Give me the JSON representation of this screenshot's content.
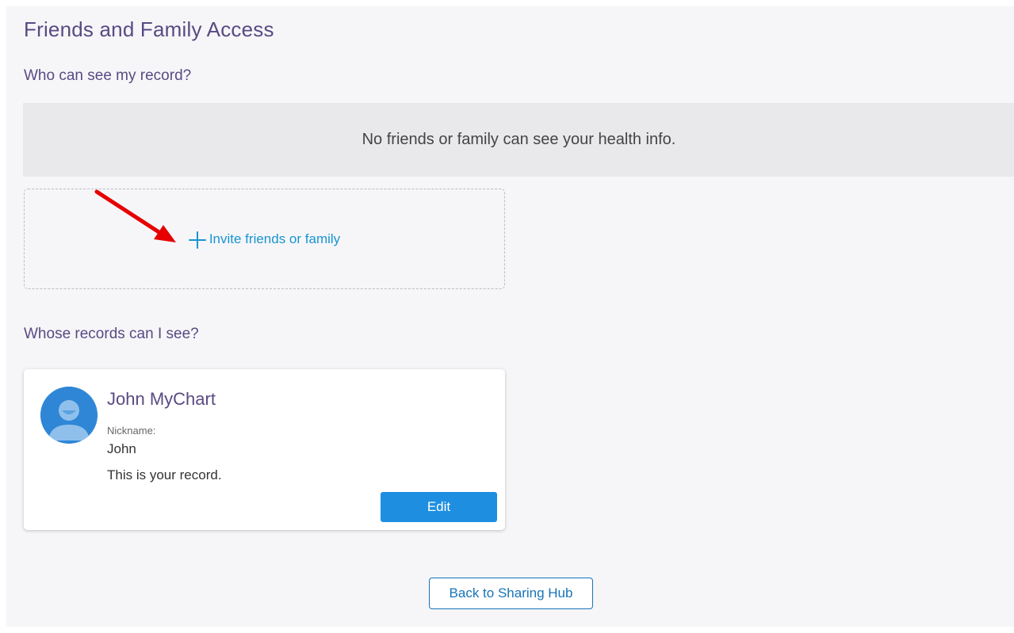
{
  "page": {
    "title": "Friends and Family Access"
  },
  "who_can_see": {
    "heading": "Who can see my record?",
    "empty_message": "No friends or family can see your health info.",
    "invite_label": "Invite friends or family"
  },
  "whose_records": {
    "heading": "Whose records can I see?",
    "records": [
      {
        "name": "John MyChart",
        "nickname_label": "Nickname:",
        "nickname": "John",
        "note": "This is your record.",
        "edit_label": "Edit"
      }
    ]
  },
  "footer": {
    "back_label": "Back to Sharing Hub"
  },
  "colors": {
    "accent": "#5a4a82",
    "link": "#1895d1",
    "button_primary": "#1e8fe0",
    "annotation_arrow": "#e60000"
  },
  "icons": {
    "invite": "plus-icon",
    "avatar": "person-avatar-icon",
    "annotation": "red-arrow-annotation"
  }
}
